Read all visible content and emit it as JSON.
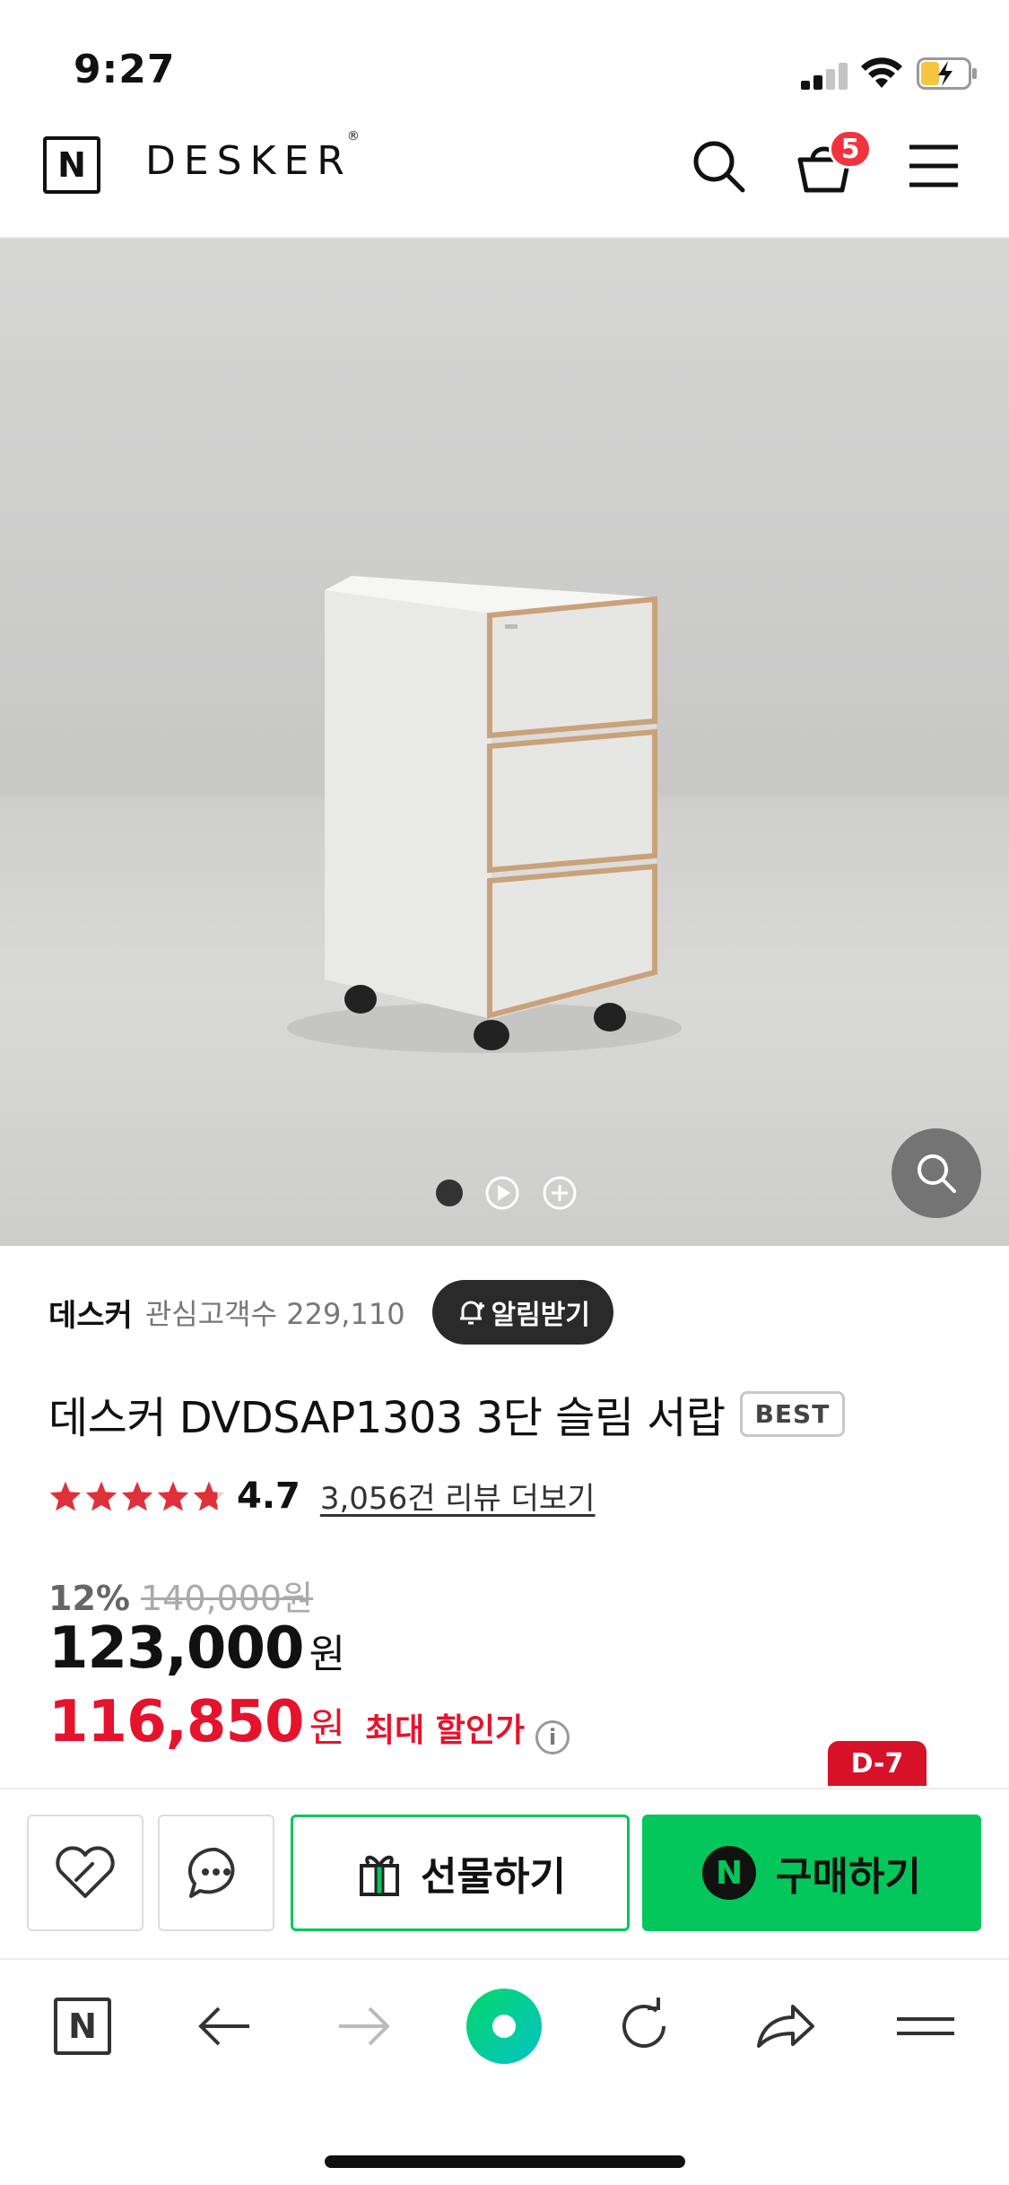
{
  "status_bar": {
    "time": "9:27"
  },
  "header": {
    "logo_letter": "N",
    "brand_name": "DESKER",
    "brand_mark": "®",
    "icons": [
      "search-icon",
      "cart-icon",
      "menu-icon"
    ],
    "cart_count": "5"
  },
  "gallery": {
    "indicators": [
      "image-dot",
      "video-play-icon",
      "more-plus-icon"
    ],
    "active_index": 0,
    "zoom_icon": "search-icon"
  },
  "product": {
    "seller_name": "데스커",
    "interest_label": "관심고객수",
    "interest_count": "229,110",
    "notify_label": "알림받기",
    "title": "데스커 DVDSAP1303 3단 슬림 서랍",
    "badge": "BEST",
    "rating_stars": 4.7,
    "rating_value": "4.7",
    "review_link": "3,056건 리뷰 더보기",
    "discount_percent": "12%",
    "original_price": "140,000원",
    "price": "123,000",
    "price_unit": "원",
    "max_price": "116,850",
    "max_price_unit": "원",
    "max_price_label": "최대 할인가",
    "info_glyph": "i",
    "dday_badge": "D-7"
  },
  "actions": {
    "wish_icon": "heart-icon",
    "talk_icon": "chat-icon",
    "gift_label": "선물하기",
    "buy_logo": "N",
    "buy_label": "구매하기"
  },
  "browser_toolbar": {
    "logo_letter": "N",
    "icons": [
      "naver-home-icon",
      "back-arrow-icon",
      "forward-arrow-icon",
      "green-dot-icon",
      "reload-icon",
      "share-icon",
      "menu-icon"
    ]
  },
  "colors": {
    "naver_green": "#03c75a",
    "sale_red": "#e5132c",
    "badge_red": "#f2333d",
    "dday_red": "#d61128",
    "star_red": "#e0303a"
  }
}
